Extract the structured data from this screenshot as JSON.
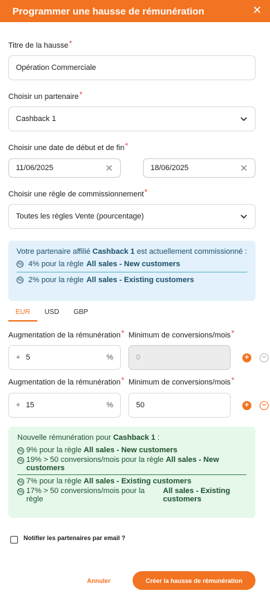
{
  "header": {
    "title": "Programmer une hausse de rémunération",
    "close": "✕"
  },
  "fields": {
    "title_label": "Titre de la hausse",
    "title_value": "Opération Commerciale",
    "partner_label": "Choisir un partenaire",
    "partner_value": "Cashback 1",
    "dates_label": "Choisir une date de début et de fin",
    "start_date": "11/06/2025",
    "end_date": "18/06/2025",
    "rule_label": "Choisir une règle de commissionnement",
    "rule_value": "Toutes les règles Vente (pourcentage)",
    "required_mark": "*"
  },
  "info": {
    "prefix": "Votre partenaire affilié ",
    "partner": "Cashback 1",
    "suffix": " est actuellement commissionné :",
    "line1_pre": "4% pour la règle ",
    "line1_rule": "All sales - New customers",
    "line2_pre": "2% pour la règle ",
    "line2_rule": "All sales - Existing customers"
  },
  "tabs": [
    "EUR",
    "USD",
    "GBP"
  ],
  "rows": [
    {
      "increase_label": "Augmentation de la rémunération",
      "min_label": "Minimum de conversions/mois",
      "prefix": "+",
      "increase": "5",
      "unit": "%",
      "min_value": "0"
    },
    {
      "increase_label": "Augmentation de la rémunération",
      "min_label": "Minimum de conversions/mois",
      "prefix": "+",
      "increase": "15",
      "unit": "%",
      "min_value": "50"
    }
  ],
  "summary": {
    "prefix": "Nouvelle rémunération pour ",
    "partner": "Cashback 1",
    "suffix": " :",
    "l1_pre": "9% pour la règle ",
    "l1_rule": "All sales - New customers",
    "l2_pre": "19% > 50 conversions/mois pour la règle ",
    "l2_rule": "All sales - New customers",
    "l3_pre": "7% pour la règle ",
    "l3_rule": "All sales - Existing customers",
    "l4_pre": "17% > 50 conversions/mois pour la règle",
    "l4_rule": "All sales - Existing customers"
  },
  "notify_label": "Notifier les partenaires par email ?",
  "buttons": {
    "cancel": "Annuler",
    "create": "Créer la hausse de rémunération"
  },
  "colors": {
    "accent": "#f27321",
    "info_bg": "#e2f1fb",
    "success_bg": "#e6f8ea"
  }
}
